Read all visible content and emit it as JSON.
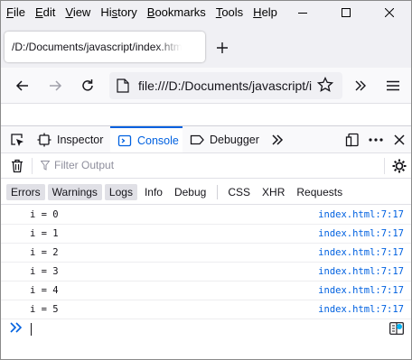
{
  "menubar": {
    "items": [
      "File",
      "Edit",
      "View",
      "History",
      "Bookmarks",
      "Tools",
      "Help"
    ],
    "accelerators": [
      "F",
      "E",
      "V",
      "s",
      "B",
      "T",
      "H"
    ]
  },
  "tab": {
    "title": "/D:/Documents/javascript/index.html"
  },
  "urlbar": {
    "url": "file:///D:/Documents/javascript/index.html"
  },
  "devtools": {
    "tabs": {
      "inspector": "Inspector",
      "console": "Console",
      "debugger": "Debugger"
    },
    "filter": {
      "placeholder": "Filter Output"
    },
    "levels": [
      "Errors",
      "Warnings",
      "Logs",
      "Info",
      "Debug"
    ],
    "types": [
      "CSS",
      "XHR",
      "Requests"
    ],
    "accent": "#0061e0"
  },
  "console": {
    "rows": [
      {
        "msg": "i = 0",
        "src": "index.html:7:17"
      },
      {
        "msg": "i = 1",
        "src": "index.html:7:17"
      },
      {
        "msg": "i = 2",
        "src": "index.html:7:17"
      },
      {
        "msg": "i = 3",
        "src": "index.html:7:17"
      },
      {
        "msg": "i = 4",
        "src": "index.html:7:17"
      },
      {
        "msg": "i = 5",
        "src": "index.html:7:17"
      }
    ]
  }
}
